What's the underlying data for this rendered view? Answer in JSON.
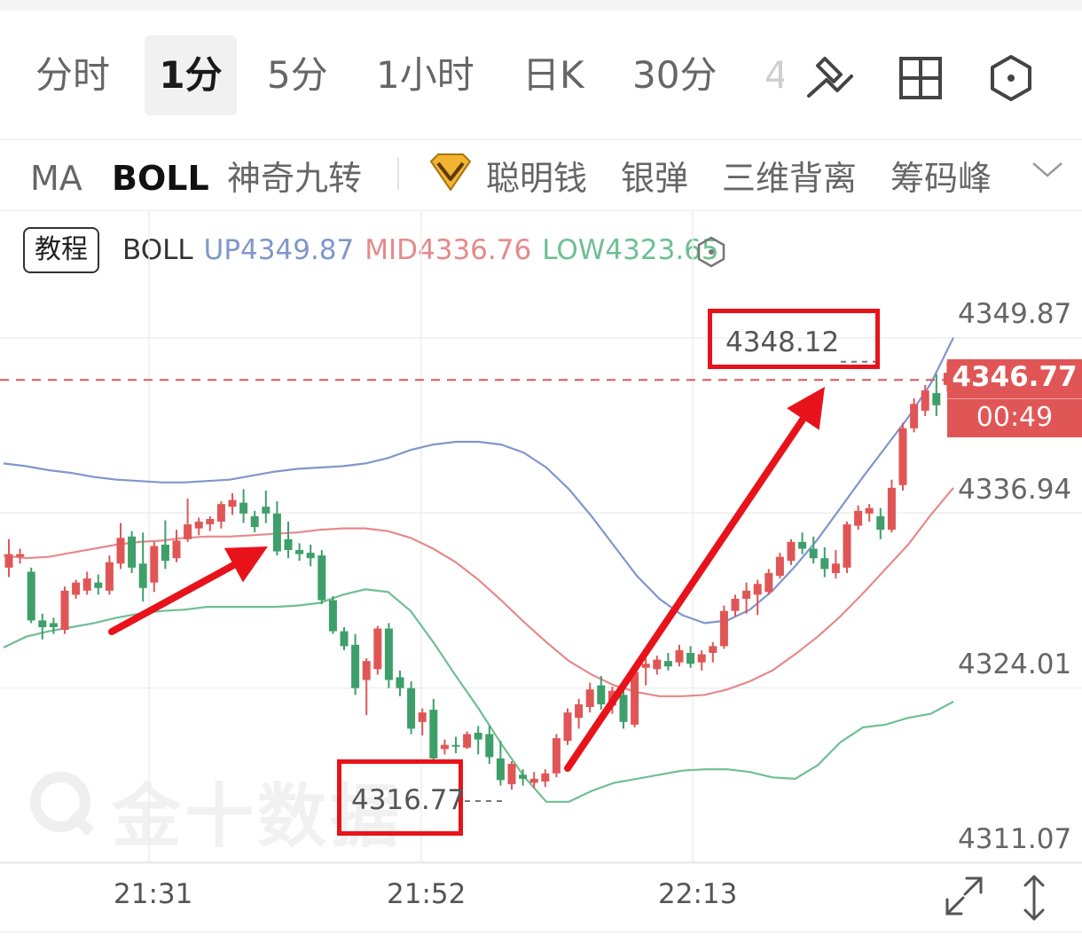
{
  "timeframes": [
    "分时",
    "1分",
    "5分",
    "1小时",
    "日K",
    "30分",
    "4"
  ],
  "active_timeframe": "1分",
  "indicators": [
    "MA",
    "BOLL",
    "神奇九转",
    "聪明钱",
    "银弹",
    "三维背离",
    "筹码峰"
  ],
  "active_indicator": "BOLL",
  "tutorial_label": "教程",
  "legend": {
    "name": "BOLL",
    "up": "UP4349.87",
    "mid": "MID4336.76",
    "low": "LOW4323.65"
  },
  "price_axis": [
    "4349.87",
    "4336.94",
    "4324.01",
    "4311.07"
  ],
  "current_price": "4346.77",
  "countdown": "00:49",
  "time_axis": [
    "21:31",
    "21:52",
    "22:13"
  ],
  "annotations": {
    "high": "4348.12",
    "low": "4316.77"
  },
  "watermark": "金十数据",
  "colors": {
    "up": "#e05656",
    "down": "#3e9f6a",
    "boll_up": "#8096cc",
    "boll_mid": "#e58a8a",
    "boll_low": "#6ebf93",
    "arrow": "#e8131a"
  },
  "chart_data": {
    "type": "candlestick",
    "y_axis_ticks": [
      4349.87,
      4336.94,
      4324.01,
      4311.07
    ],
    "x_axis_ticks": [
      "21:31",
      "21:52",
      "22:13"
    ],
    "current_price": 4346.77,
    "marked_high": 4348.12,
    "marked_low": 4316.77,
    "series": [
      {
        "name": "UP",
        "last": 4349.87,
        "values": [
          4340.6,
          4340.4,
          4340.1,
          4339.9,
          4339.6,
          4339.4,
          4339.3,
          4339.2,
          4339.2,
          4339.3,
          4339.4,
          4339.7,
          4340.0,
          4340.2,
          4340.3,
          4340.4,
          4340.6,
          4341.0,
          4341.6,
          4342.0,
          4342.2,
          4342.2,
          4342.0,
          4341.4,
          4340.3,
          4338.7,
          4336.7,
          4334.5,
          4332.3,
          4330.6,
          4329.4,
          4328.8,
          4329.0,
          4329.8,
          4331.2,
          4333.0,
          4335.0,
          4337.3,
          4339.6,
          4341.8,
          4344.0,
          4346.5,
          4349.9
        ]
      },
      {
        "name": "MID",
        "last": 4336.76,
        "values": [
          4333.8,
          4333.6,
          4333.7,
          4334.0,
          4334.3,
          4334.6,
          4334.8,
          4334.9,
          4335.1,
          4335.2,
          4335.2,
          4335.3,
          4335.4,
          4335.5,
          4335.7,
          4335.8,
          4335.8,
          4335.6,
          4335.1,
          4334.3,
          4333.3,
          4332.0,
          4330.5,
          4328.9,
          4327.4,
          4326.0,
          4325.0,
          4324.2,
          4323.7,
          4323.4,
          4323.4,
          4323.5,
          4323.9,
          4324.5,
          4325.3,
          4326.5,
          4327.8,
          4329.3,
          4331.0,
          4332.8,
          4334.6,
          4336.8,
          4338.8
        ]
      },
      {
        "name": "LOW",
        "last": 4323.65,
        "values": [
          4327.0,
          4327.8,
          4328.2,
          4328.5,
          4328.8,
          4329.2,
          4329.5,
          4329.7,
          4329.8,
          4330.0,
          4330.0,
          4330.0,
          4330.0,
          4330.1,
          4330.3,
          4330.9,
          4331.3,
          4331.1,
          4329.7,
          4327.4,
          4324.9,
          4322.5,
          4319.9,
          4317.5,
          4315.6,
          4315.6,
          4316.4,
          4317.0,
          4317.3,
          4317.6,
          4317.9,
          4318.0,
          4318.0,
          4317.8,
          4317.4,
          4317.3,
          4318.3,
          4320.0,
          4321.1,
          4321.3,
          4321.8,
          4322.1,
          4323.0
        ]
      }
    ],
    "candles": [
      {
        "o": 4332.9,
        "h": 4335.0,
        "l": 4332.2,
        "c": 4333.9
      },
      {
        "o": 4333.7,
        "h": 4334.3,
        "l": 4333.2,
        "c": 4333.9
      },
      {
        "o": 4332.6,
        "h": 4332.9,
        "l": 4328.8,
        "c": 4329.0
      },
      {
        "o": 4329.0,
        "h": 4329.5,
        "l": 4327.6,
        "c": 4328.5
      },
      {
        "o": 4328.8,
        "h": 4329.2,
        "l": 4328.0,
        "c": 4328.5
      },
      {
        "o": 4328.3,
        "h": 4331.5,
        "l": 4328.0,
        "c": 4331.2
      },
      {
        "o": 4330.9,
        "h": 4332.0,
        "l": 4330.6,
        "c": 4331.8
      },
      {
        "o": 4331.2,
        "h": 4332.6,
        "l": 4330.9,
        "c": 4332.1
      },
      {
        "o": 4331.8,
        "h": 4332.4,
        "l": 4330.9,
        "c": 4331.4
      },
      {
        "o": 4331.2,
        "h": 4333.8,
        "l": 4330.9,
        "c": 4333.3
      },
      {
        "o": 4333.2,
        "h": 4336.2,
        "l": 4332.8,
        "c": 4335.1
      },
      {
        "o": 4335.2,
        "h": 4335.6,
        "l": 4332.5,
        "c": 4332.9
      },
      {
        "o": 4333.2,
        "h": 4335.5,
        "l": 4330.4,
        "c": 4331.4
      },
      {
        "o": 4331.8,
        "h": 4334.8,
        "l": 4331.1,
        "c": 4334.5
      },
      {
        "o": 4334.6,
        "h": 4336.4,
        "l": 4332.8,
        "c": 4333.4
      },
      {
        "o": 4333.6,
        "h": 4335.7,
        "l": 4333.3,
        "c": 4334.9
      },
      {
        "o": 4335.0,
        "h": 4338.0,
        "l": 4334.8,
        "c": 4336.1
      },
      {
        "o": 4335.8,
        "h": 4336.6,
        "l": 4335.3,
        "c": 4336.3
      },
      {
        "o": 4336.1,
        "h": 4336.7,
        "l": 4335.6,
        "c": 4336.5
      },
      {
        "o": 4336.3,
        "h": 4337.8,
        "l": 4335.8,
        "c": 4337.6
      },
      {
        "o": 4337.4,
        "h": 4338.4,
        "l": 4336.8,
        "c": 4337.9
      },
      {
        "o": 4337.7,
        "h": 4338.7,
        "l": 4336.2,
        "c": 4336.9
      },
      {
        "o": 4336.7,
        "h": 4337.1,
        "l": 4335.5,
        "c": 4335.9
      },
      {
        "o": 4337.4,
        "h": 4338.6,
        "l": 4336.2,
        "c": 4336.9
      },
      {
        "o": 4336.9,
        "h": 4337.8,
        "l": 4333.8,
        "c": 4334.1
      },
      {
        "o": 4335.0,
        "h": 4336.3,
        "l": 4333.6,
        "c": 4334.2
      },
      {
        "o": 4334.2,
        "h": 4334.7,
        "l": 4333.4,
        "c": 4333.9
      },
      {
        "o": 4334.0,
        "h": 4334.6,
        "l": 4333.0,
        "c": 4333.6
      },
      {
        "o": 4333.8,
        "h": 4334.2,
        "l": 4330.2,
        "c": 4330.5
      },
      {
        "o": 4330.5,
        "h": 4330.8,
        "l": 4328.0,
        "c": 4328.2
      },
      {
        "o": 4328.2,
        "h": 4328.5,
        "l": 4326.8,
        "c": 4327.1
      },
      {
        "o": 4327.2,
        "h": 4328.0,
        "l": 4323.5,
        "c": 4324.0
      },
      {
        "o": 4324.6,
        "h": 4326.2,
        "l": 4322.0,
        "c": 4326.0
      },
      {
        "o": 4325.4,
        "h": 4328.6,
        "l": 4325.0,
        "c": 4328.4
      },
      {
        "o": 4328.4,
        "h": 4328.8,
        "l": 4324.0,
        "c": 4324.6
      },
      {
        "o": 4324.8,
        "h": 4325.3,
        "l": 4323.4,
        "c": 4324.0
      },
      {
        "o": 4324.0,
        "h": 4324.5,
        "l": 4320.6,
        "c": 4321.0
      },
      {
        "o": 4321.5,
        "h": 4322.5,
        "l": 4320.5,
        "c": 4322.2
      },
      {
        "o": 4322.4,
        "h": 4323.2,
        "l": 4318.4,
        "c": 4318.8
      },
      {
        "o": 4319.5,
        "h": 4320.2,
        "l": 4319.1,
        "c": 4319.8
      },
      {
        "o": 4319.8,
        "h": 4320.4,
        "l": 4319.2,
        "c": 4319.7
      },
      {
        "o": 4319.6,
        "h": 4320.8,
        "l": 4319.5,
        "c": 4320.6
      },
      {
        "o": 4320.7,
        "h": 4321.2,
        "l": 4319.1,
        "c": 4320.2
      },
      {
        "o": 4320.6,
        "h": 4321.2,
        "l": 4318.4,
        "c": 4318.9
      },
      {
        "o": 4318.8,
        "h": 4320.1,
        "l": 4316.8,
        "c": 4317.2
      },
      {
        "o": 4316.9,
        "h": 4318.6,
        "l": 4316.5,
        "c": 4318.4
      },
      {
        "o": 4317.6,
        "h": 4318.0,
        "l": 4316.8,
        "c": 4317.3
      },
      {
        "o": 4317.0,
        "h": 4317.8,
        "l": 4316.6,
        "c": 4317.3
      },
      {
        "o": 4317.1,
        "h": 4318.0,
        "l": 4316.7,
        "c": 4317.7
      },
      {
        "o": 4317.7,
        "h": 4320.6,
        "l": 4317.4,
        "c": 4320.3
      },
      {
        "o": 4320.1,
        "h": 4322.5,
        "l": 4319.8,
        "c": 4322.2
      },
      {
        "o": 4321.8,
        "h": 4323.2,
        "l": 4321.0,
        "c": 4322.8
      },
      {
        "o": 4322.6,
        "h": 4324.4,
        "l": 4322.2,
        "c": 4323.9
      },
      {
        "o": 4324.2,
        "h": 4324.9,
        "l": 4322.4,
        "c": 4322.8
      },
      {
        "o": 4322.7,
        "h": 4324.1,
        "l": 4322.1,
        "c": 4323.8
      },
      {
        "o": 4323.5,
        "h": 4324.3,
        "l": 4321.0,
        "c": 4321.5
      },
      {
        "o": 4321.3,
        "h": 4325.7,
        "l": 4321.1,
        "c": 4325.2
      },
      {
        "o": 4325.5,
        "h": 4326.2,
        "l": 4324.2,
        "c": 4325.8
      },
      {
        "o": 4325.4,
        "h": 4326.4,
        "l": 4325.0,
        "c": 4326.1
      },
      {
        "o": 4326.0,
        "h": 4326.6,
        "l": 4325.3,
        "c": 4325.6
      },
      {
        "o": 4325.9,
        "h": 4327.2,
        "l": 4325.6,
        "c": 4326.8
      },
      {
        "o": 4326.6,
        "h": 4327.1,
        "l": 4325.5,
        "c": 4325.8
      },
      {
        "o": 4325.9,
        "h": 4326.8,
        "l": 4325.3,
        "c": 4326.5
      },
      {
        "o": 4326.6,
        "h": 4327.4,
        "l": 4325.9,
        "c": 4327.1
      },
      {
        "o": 4327.1,
        "h": 4330.1,
        "l": 4326.9,
        "c": 4329.7
      },
      {
        "o": 4329.7,
        "h": 4330.9,
        "l": 4329.3,
        "c": 4330.6
      },
      {
        "o": 4330.6,
        "h": 4331.8,
        "l": 4329.5,
        "c": 4331.2
      },
      {
        "o": 4330.9,
        "h": 4332.0,
        "l": 4329.4,
        "c": 4331.7
      },
      {
        "o": 4331.1,
        "h": 4332.8,
        "l": 4330.9,
        "c": 4332.5
      },
      {
        "o": 4332.3,
        "h": 4334.0,
        "l": 4332.1,
        "c": 4333.7
      },
      {
        "o": 4333.4,
        "h": 4335.0,
        "l": 4333.1,
        "c": 4334.8
      },
      {
        "o": 4334.8,
        "h": 4335.5,
        "l": 4333.9,
        "c": 4334.3
      },
      {
        "o": 4334.3,
        "h": 4335.2,
        "l": 4333.2,
        "c": 4333.6
      },
      {
        "o": 4333.6,
        "h": 4334.4,
        "l": 4332.2,
        "c": 4332.8
      },
      {
        "o": 4332.5,
        "h": 4334.2,
        "l": 4332.1,
        "c": 4333.2
      },
      {
        "o": 4332.9,
        "h": 4336.3,
        "l": 4332.5,
        "c": 4336.1
      },
      {
        "o": 4336.0,
        "h": 4337.5,
        "l": 4335.7,
        "c": 4337.1
      },
      {
        "o": 4336.9,
        "h": 4337.6,
        "l": 4336.3,
        "c": 4337.3
      },
      {
        "o": 4336.7,
        "h": 4337.3,
        "l": 4335.0,
        "c": 4335.7
      },
      {
        "o": 4335.7,
        "h": 4339.4,
        "l": 4335.5,
        "c": 4338.8
      },
      {
        "o": 4339.0,
        "h": 4343.6,
        "l": 4338.6,
        "c": 4343.2
      },
      {
        "o": 4343.2,
        "h": 4345.4,
        "l": 4342.9,
        "c": 4345.0
      },
      {
        "o": 4344.5,
        "h": 4346.4,
        "l": 4344.1,
        "c": 4346.0
      },
      {
        "o": 4345.8,
        "h": 4347.2,
        "l": 4344.1,
        "c": 4344.9
      },
      {
        "o": 4346.4,
        "h": 4348.1,
        "l": 4345.9,
        "c": 4347.3
      },
      {
        "o": 4346.8,
        "h": 4347.5,
        "l": 4345.1,
        "c": 4345.6
      }
    ]
  }
}
